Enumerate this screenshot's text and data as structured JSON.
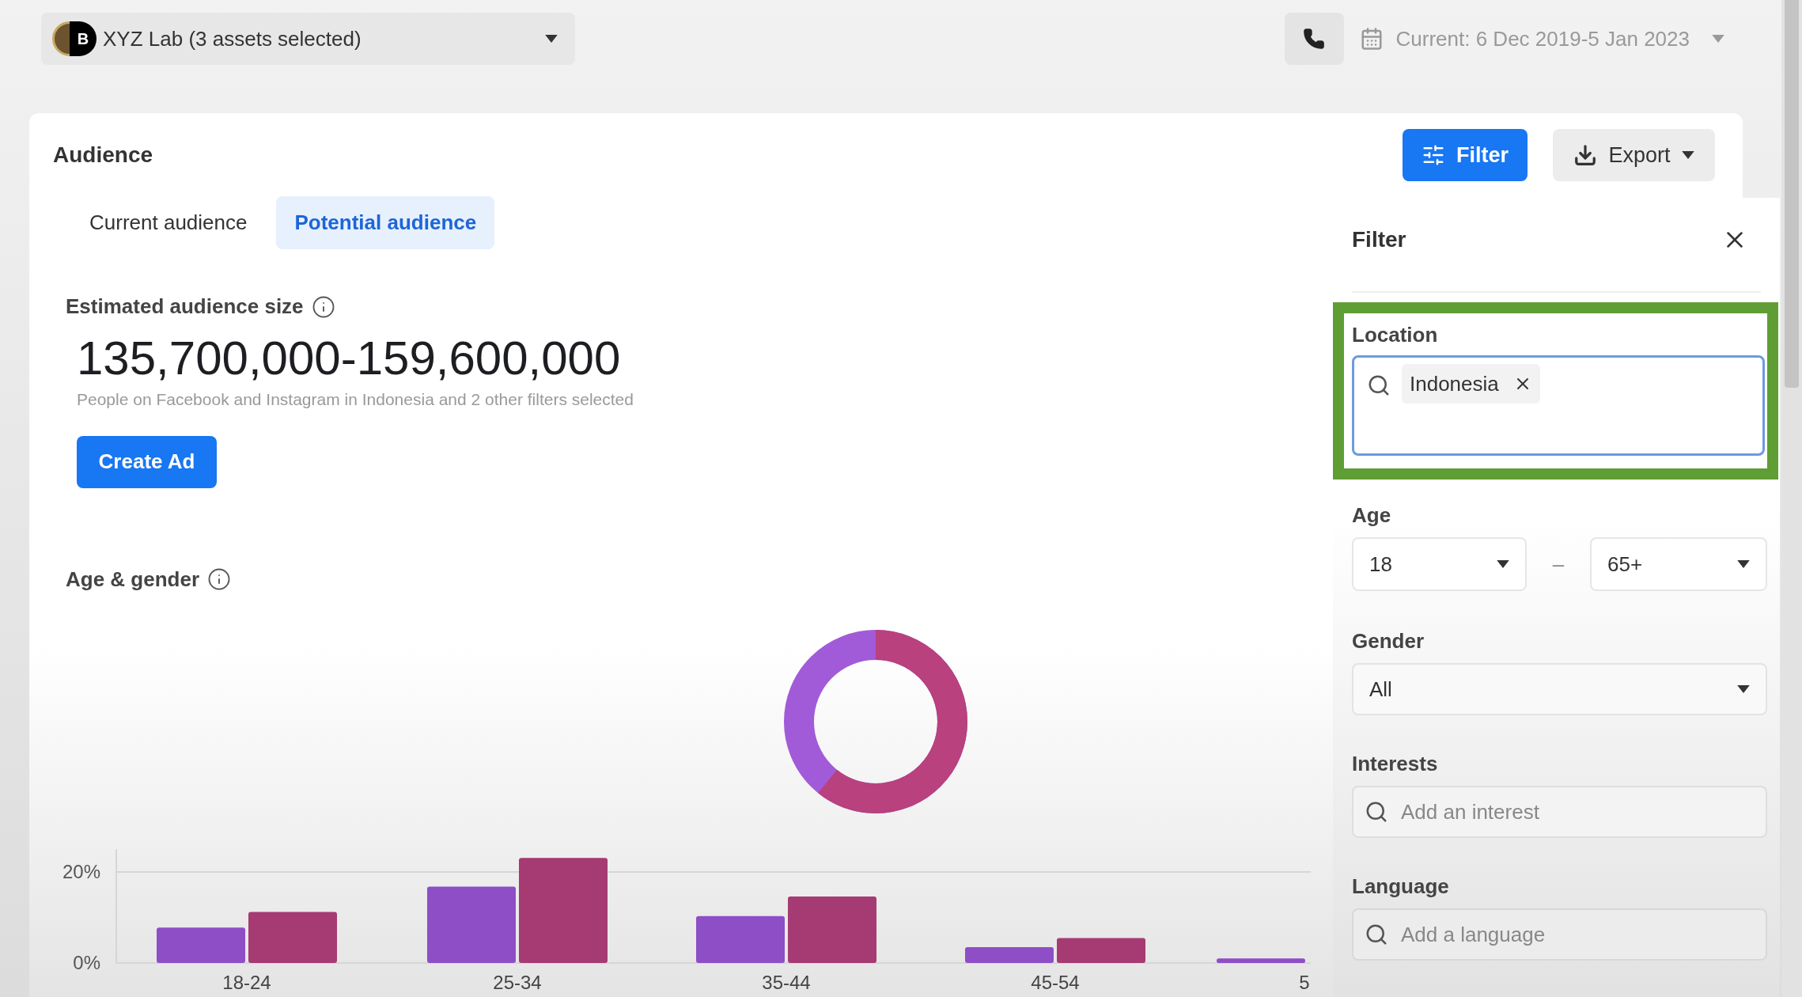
{
  "account_selector": {
    "avatar_letter": "B",
    "label": "XYZ Lab (3 assets selected)"
  },
  "date_range": {
    "label": "Current: 6 Dec 2019-5 Jan 2023"
  },
  "audience": {
    "title": "Audience",
    "tabs": [
      {
        "label": "Current audience",
        "selected": false
      },
      {
        "label": "Potential audience",
        "selected": true
      }
    ],
    "estimate": {
      "label": "Estimated audience size",
      "value": "135,700,000-159,600,000",
      "description": "People on Facebook and Instagram in Indonesia and 2 other filters selected"
    },
    "create_button": "Create Ad",
    "age_gender": {
      "title": "Age & gender",
      "chart_data": {
        "type": "bar",
        "categories": [
          "18-24",
          "25-34",
          "35-44",
          "45-54",
          "5"
        ],
        "series": [
          {
            "color": "#8e4ec6",
            "values": [
              7.8,
              16.8,
              10.3,
              3.5,
              1
            ]
          },
          {
            "color": "#a63a72",
            "values": [
              11.2,
              23.1,
              14.6,
              5.5,
              null
            ]
          }
        ],
        "ylim": [
          0,
          25
        ],
        "yticks": [
          {
            "value": 0,
            "label": "0%"
          },
          {
            "value": 20,
            "label": "20%"
          }
        ]
      }
    }
  },
  "toolbar": {
    "filter_button": "Filter",
    "export_button": "Export"
  },
  "filter_panel": {
    "title": "Filter",
    "location": {
      "label": "Location",
      "tags": [
        "Indonesia"
      ],
      "highlighted": true
    },
    "age": {
      "label": "Age",
      "min": "18",
      "separator": "–",
      "max": "65+"
    },
    "gender": {
      "label": "Gender",
      "value": "All"
    },
    "interests": {
      "label": "Interests",
      "placeholder": "Add an interest"
    },
    "language": {
      "label": "Language",
      "placeholder": "Add a language"
    }
  }
}
